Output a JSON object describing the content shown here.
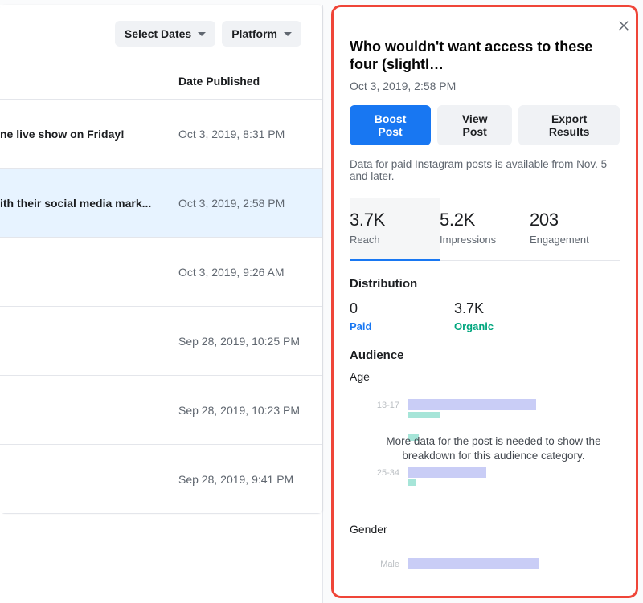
{
  "filters": {
    "select_dates": "Select Dates",
    "platform": "Platform"
  },
  "column_header": "Date Published",
  "rows": [
    {
      "title": "ne live show on Friday!",
      "date": "Oct 3, 2019, 8:31 PM",
      "selected": false
    },
    {
      "title": "ith their social media mark...",
      "date": "Oct 3, 2019, 2:58 PM",
      "selected": true
    },
    {
      "title": "",
      "date": "Oct 3, 2019, 9:26 AM",
      "selected": false
    },
    {
      "title": "",
      "date": "Sep 28, 2019, 10:25 PM",
      "selected": false
    },
    {
      "title": "",
      "date": "Sep 28, 2019, 10:23 PM",
      "selected": false
    },
    {
      "title": "",
      "date": "Sep 28, 2019, 9:41 PM",
      "selected": false
    }
  ],
  "detail": {
    "title": "Who wouldn't want access to these four (slightl…",
    "timestamp": "Oct 3, 2019, 2:58 PM",
    "buttons": {
      "boost": "Boost Post",
      "view": "View Post",
      "export": "Export Results"
    },
    "note": "Data for paid Instagram posts is available from Nov. 5 and later.",
    "metrics": [
      {
        "value": "3.7K",
        "label": "Reach",
        "active": true
      },
      {
        "value": "5.2K",
        "label": "Impressions",
        "active": false
      },
      {
        "value": "203",
        "label": "Engagement",
        "active": false
      }
    ],
    "distribution": {
      "heading": "Distribution",
      "paid_value": "0",
      "paid_label": "Paid",
      "organic_value": "3.7K",
      "organic_label": "Organic"
    },
    "audience": {
      "heading": "Audience",
      "age_label": "Age",
      "overlay": "More data for the post is needed to show the breakdown for this audience category.",
      "age_rows": [
        {
          "label": "13-17",
          "b1": 160,
          "b2": 40
        },
        {
          "label": "",
          "b1": 0,
          "b2": 14
        },
        {
          "label": "25-34",
          "b1": 98,
          "b2": 10
        }
      ],
      "gender_label": "Gender",
      "gender_rows": [
        {
          "label": "Male",
          "b1": 164,
          "b2": 0
        }
      ]
    }
  }
}
